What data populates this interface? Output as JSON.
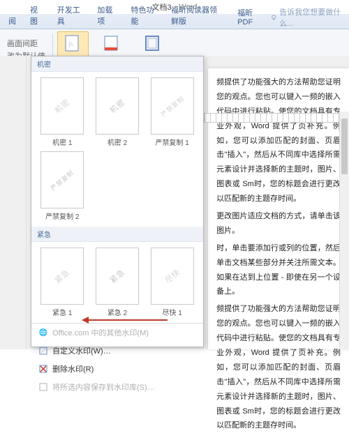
{
  "window": {
    "doc": "文档3",
    "app": "Word"
  },
  "tabs": {
    "items": [
      "阅",
      "视图",
      "开发工具",
      "加载项",
      "特色功能",
      "福昕阅读器领鲜版",
      "福昕PDF"
    ],
    "tellme": "告诉我您想要做什么..."
  },
  "ribbon": {
    "leftGroup": {
      "line1": "画面间距",
      "line2": "改为默认值"
    },
    "watermark": "水印",
    "pageColor": "页面颜色",
    "pageBorder": "页面边框"
  },
  "wm": {
    "sec1": "机密",
    "grid1": [
      {
        "txt": "机密",
        "cap": "机密 1"
      },
      {
        "txt": "机密",
        "cap": "机密 2"
      },
      {
        "txt": "严禁复制",
        "cap": "严禁复制 1"
      },
      {
        "txt": "严禁复制",
        "cap": "严禁复制 2"
      }
    ],
    "sec2": "紧急",
    "grid2": [
      {
        "txt": "紧急",
        "cap": "紧急 1"
      },
      {
        "txt": "紧急",
        "cap": "紧急 2"
      },
      {
        "txt": "尽快",
        "cap": "尽快 1"
      }
    ],
    "menu": {
      "office": "Office.com 中的其他水印(M)",
      "custom": "自定义水印(W)…",
      "remove": "删除水印(R)",
      "save": "将所选内容保存到水印库(S)…"
    }
  },
  "doc": {
    "p1": "频提供了功能强大的方法帮助您证明您的观点。您也可以键入一频的嵌入代码中进行粘贴。使您的文档具有专业外观，Word 提供了页补充。例如，您可以添加匹配的封面、页眉击\"插入\"，然后从不同库中选择所需元素设计并选择新的主题时，图片、图表或 Sm时，您的标题会进行更改以匹配新的主题存时间。",
    "p2": "更改图片适应文档的方式，请单击该图片。",
    "p3": "时，单击要添加行或列的位置，然后单击文档某些部分并关注所需文本。如果在达到上位置 - 即使在另一个设备上。",
    "p4": "频提供了功能强大的方法帮助您证明您的观点。您也可以键入一频的嵌入代码中进行粘贴。使您的文档具有专业外观，Word 提供了页补充。例如，您可以添加匹配的封面、页眉击\"插入\"，然后从不同库中选择所需元素设计并选择新的主题时，图片、图表或 Sm时，您的标题会进行更改以匹配新的主题存时间。"
  }
}
